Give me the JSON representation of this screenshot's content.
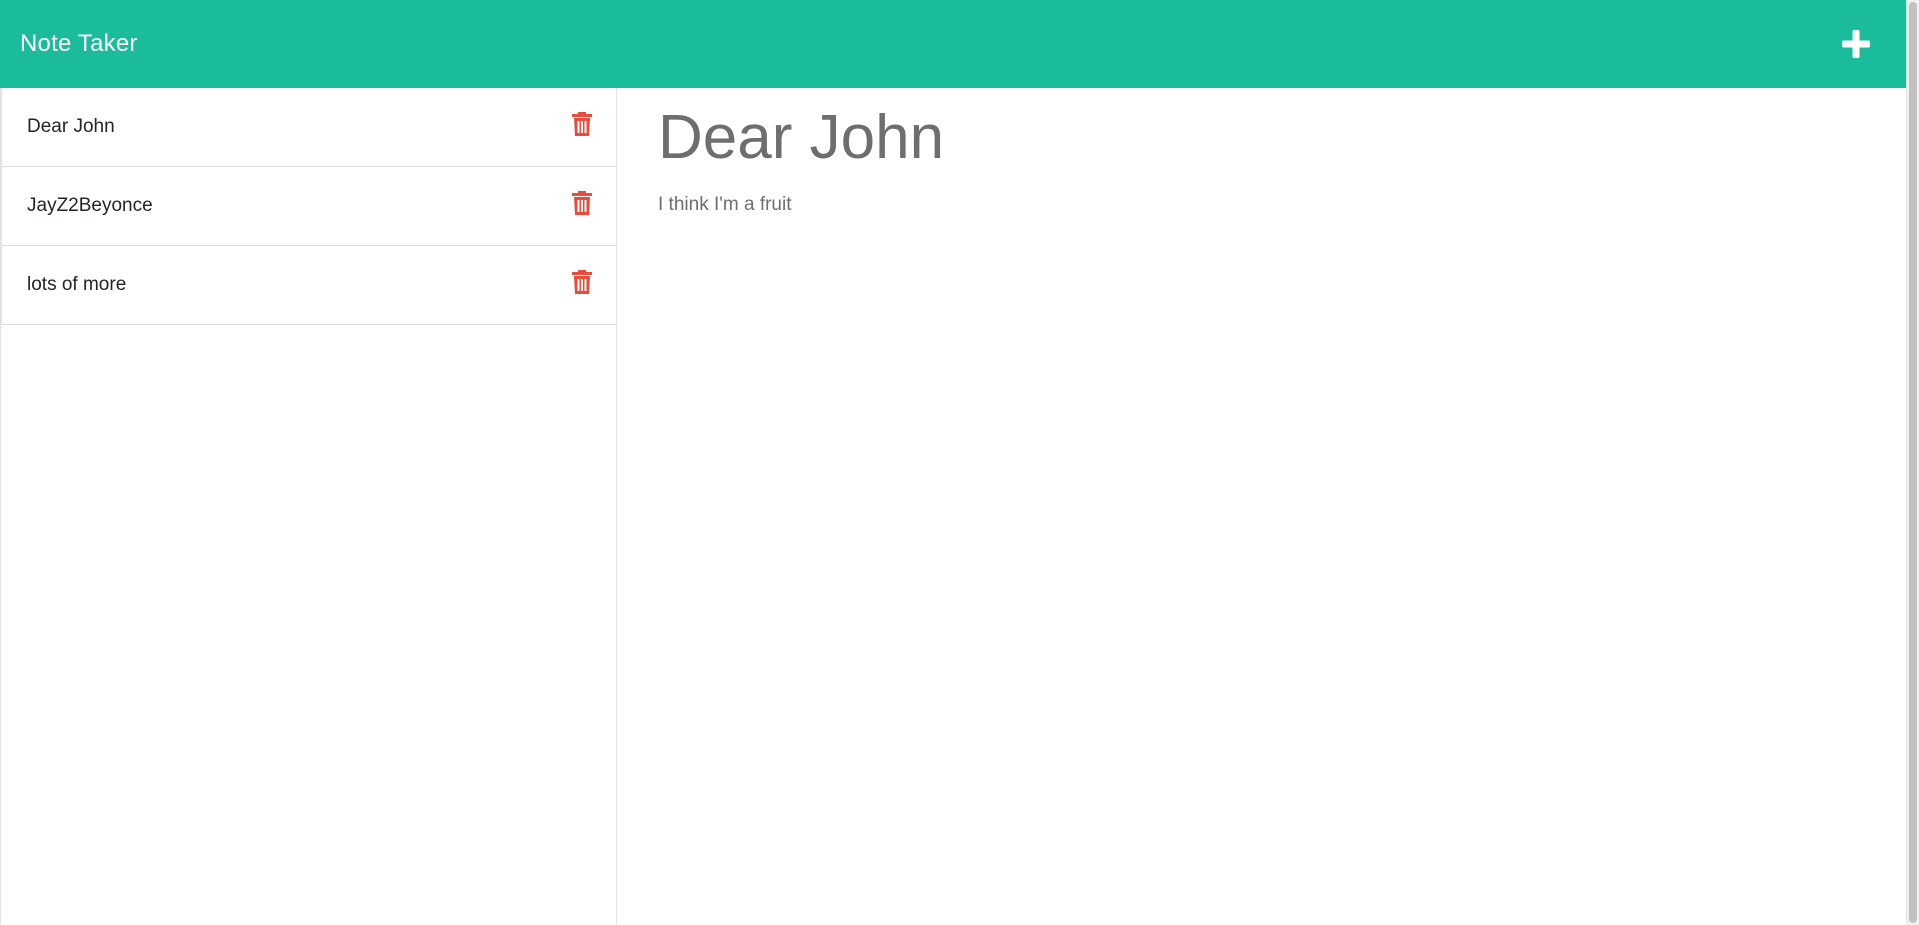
{
  "app": {
    "title": "Note Taker",
    "accent_color": "#1abc9c",
    "delete_color": "#e74c3c",
    "add_icon": "plus-icon",
    "delete_icon": "trash-icon"
  },
  "notes": [
    {
      "title": "Dear John"
    },
    {
      "title": "JayZ2Beyonce"
    },
    {
      "title": "lots of more"
    }
  ],
  "active_note": {
    "title": "Dear John",
    "text": "I think I'm a fruit"
  }
}
